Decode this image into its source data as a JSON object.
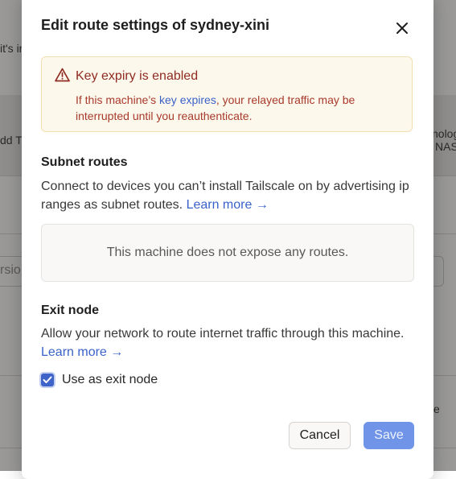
{
  "background": {
    "snippet_top": "it's in",
    "snippet_left": "dd T",
    "snippet_right1": "nolog",
    "snippet_right2": "NAS",
    "snippet_input": "rsio",
    "snippet_bottom_right": "e"
  },
  "dialog": {
    "title": "Edit route settings of sydney-xini",
    "close_icon": "close-icon",
    "alert": {
      "icon": "warning-triangle-icon",
      "title": "Key expiry is enabled",
      "body_before": "If this machine’s ",
      "body_link": "key expires",
      "body_after": ", your relayed traffic may be interrupted until you reauthenticate."
    },
    "subnet": {
      "heading": "Subnet routes",
      "description": "Connect to devices you can’t install Tailscale on by advertising ip ranges as subnet routes.",
      "learn_more": "Learn more →",
      "empty_text": "This machine does not expose any routes."
    },
    "exit_node": {
      "heading": "Exit node",
      "description": "Allow your network to route internet traffic through this machine.",
      "learn_more": "Learn more →",
      "checkbox_label": "Use as exit node",
      "checked": true
    },
    "buttons": {
      "cancel": "Cancel",
      "save": "Save"
    }
  },
  "colors": {
    "accent": "#3e63c9",
    "alert_bg": "#fdf8ec",
    "alert_text": "#8f2b22",
    "save_disabled": "#6f94e8"
  }
}
